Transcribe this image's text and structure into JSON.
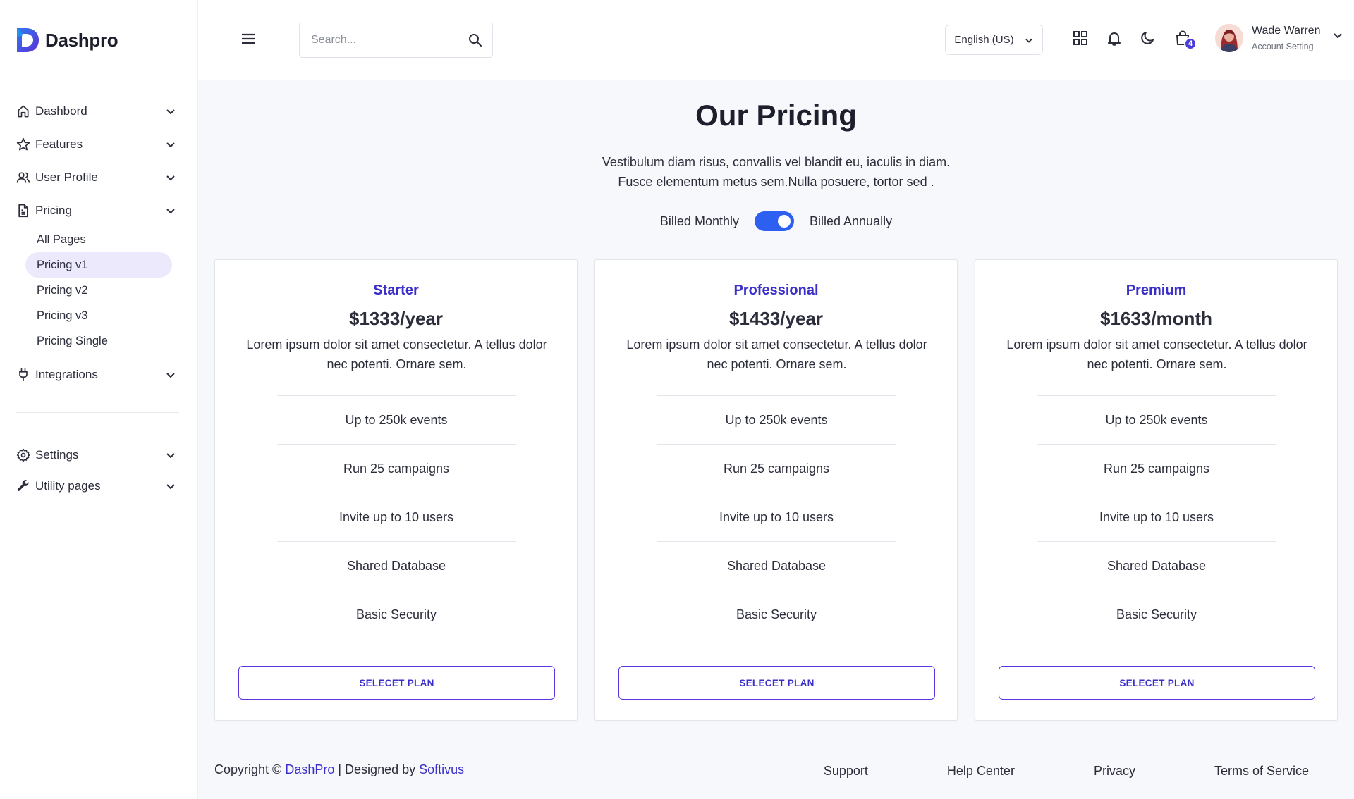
{
  "brand": {
    "name": "Dashpro"
  },
  "sidebar": {
    "items": [
      {
        "label": "Dashbord",
        "icon": "home-icon"
      },
      {
        "label": "Features",
        "icon": "star-icon"
      },
      {
        "label": "User Profile",
        "icon": "users-icon"
      },
      {
        "label": "Pricing",
        "icon": "document-icon"
      },
      {
        "label": "Integrations",
        "icon": "plug-icon"
      },
      {
        "label": "Settings",
        "icon": "gear-icon"
      },
      {
        "label": "Utility pages",
        "icon": "wrench-icon"
      }
    ],
    "pricing_sub": [
      "All Pages",
      "Pricing v1",
      "Pricing v2",
      "Pricing v3",
      "Pricing Single"
    ],
    "active_sub": "Pricing v1"
  },
  "header": {
    "search_placeholder": "Search...",
    "language": "English (US)",
    "cart_count": "4",
    "user_name": "Wade Warren",
    "user_sub": "Account Setting"
  },
  "pricing": {
    "title": "Our Pricing",
    "subtitle_line1": "Vestibulum diam risus, convallis vel blandit eu, iaculis in diam.",
    "subtitle_line2": "Fusce elementum metus sem.Nulla posuere, tortor sed .",
    "billed_monthly": "Billed Monthly",
    "billed_annually": "Billed Annually",
    "plans": [
      {
        "name": "Starter",
        "price": "$1333/year",
        "description": "Lorem ipsum dolor sit amet consectetur. A tellus dolor nec potenti. Ornare sem.",
        "features": [
          "Up to 250k events",
          "Run 25 campaigns",
          "Invite up to 10 users",
          "Shared Database",
          "Basic Security"
        ],
        "button": "SELECET PLAN"
      },
      {
        "name": "Professional",
        "price": "$1433/year",
        "description": "Lorem ipsum dolor sit amet consectetur. A tellus dolor nec potenti. Ornare sem.",
        "features": [
          "Up to 250k events",
          "Run 25 campaigns",
          "Invite up to 10 users",
          "Shared Database",
          "Basic Security"
        ],
        "button": "SELECET PLAN"
      },
      {
        "name": "Premium",
        "price": "$1633/month",
        "description": "Lorem ipsum dolor sit amet consectetur. A tellus dolor nec potenti. Ornare sem.",
        "features": [
          "Up to 250k events",
          "Run 25 campaigns",
          "Invite up to 10 users",
          "Shared Database",
          "Basic Security"
        ],
        "button": "SELECET PLAN"
      }
    ]
  },
  "footer": {
    "copyright_prefix": "Copyright ©",
    "brand_link": "DashPro",
    "designed_by": "| Designed by",
    "designer_link": "Softivus",
    "links": [
      "Support",
      "Help Center",
      "Privacy",
      "Terms of Service"
    ]
  },
  "colors": {
    "accent": "#3b2fc9",
    "toggle": "#2d5ff0",
    "active_bg": "#ebe9fb"
  }
}
